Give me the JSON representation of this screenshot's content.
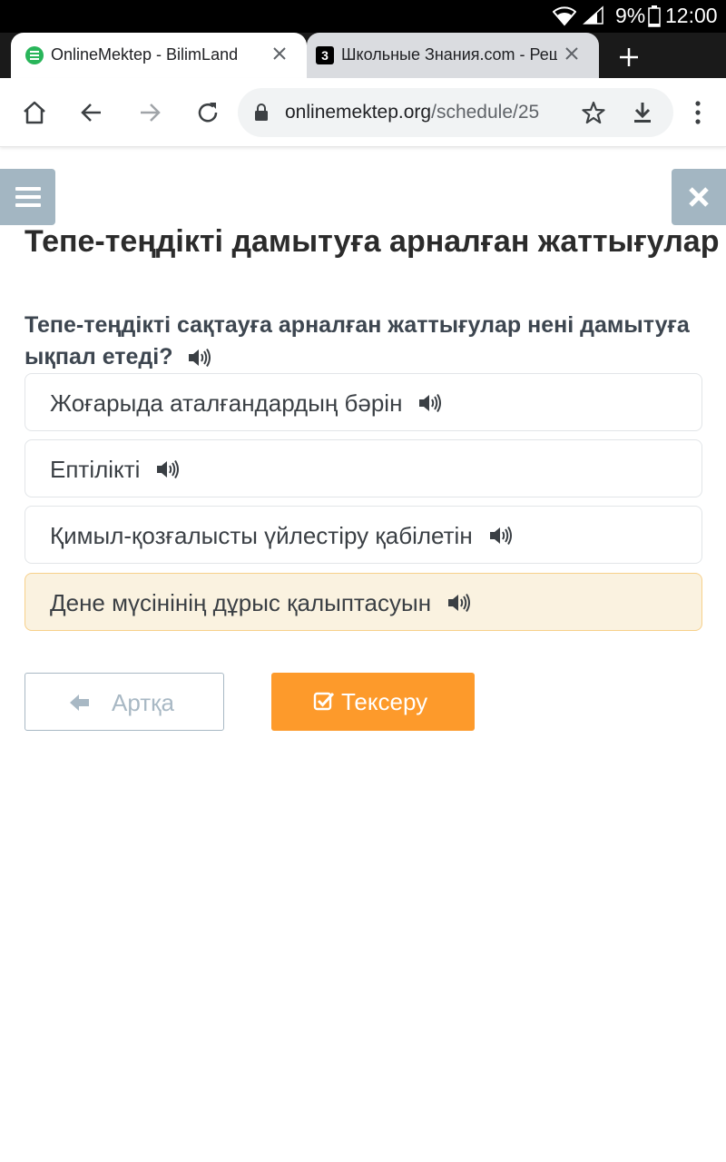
{
  "status_bar": {
    "battery_pct": "9%",
    "time": "12:00"
  },
  "tabs": [
    {
      "title": "OnlineMektep - BilimLand",
      "active": true
    },
    {
      "title": "Школьные Знания.com - Решайте",
      "active": false
    }
  ],
  "toolbar": {
    "url_host": "onlinemektep.org",
    "url_path": "/schedule/25"
  },
  "page": {
    "title": "Тепе-теңдікті дамытуға арналған жаттығулар",
    "question": "Тепе-теңдікті сақтауға арналған жаттығулар нені дамытуға ықпал етеді?",
    "options": [
      {
        "text": "Жоғарыда аталғандардың бәрін",
        "selected": false
      },
      {
        "text": "Ептілікті",
        "selected": false
      },
      {
        "text": "Қимыл-қозғалысты үйлестіру қабілетін",
        "selected": false
      },
      {
        "text": "Дене мүсінінің дұрыс қалыптасуын",
        "selected": true
      }
    ],
    "back_label": "Артқа",
    "check_label": "Тексеру"
  },
  "colors": {
    "accent": "#fd9a2b",
    "side_button": "#a3b6c2",
    "selected_bg": "#faf2e0"
  }
}
